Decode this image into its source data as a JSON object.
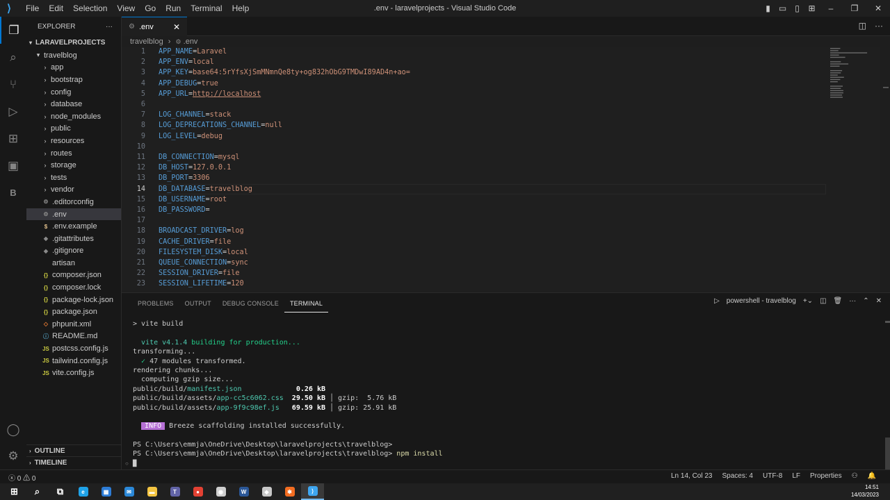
{
  "window": {
    "title": ".env - laravelprojects - Visual Studio Code",
    "menu": [
      "File",
      "Edit",
      "Selection",
      "View",
      "Go",
      "Run",
      "Terminal",
      "Help"
    ]
  },
  "activity": {
    "icons": [
      "files-icon",
      "search-icon",
      "source-control-icon",
      "run-debug-icon",
      "extensions-icon",
      "remote-explorer-icon",
      "b-extension-icon"
    ],
    "bottom_icons": [
      "account-icon",
      "settings-gear-icon"
    ]
  },
  "sidebar": {
    "header": "EXPLORER",
    "root": "LARAVELPROJECTS",
    "items": [
      {
        "label": "travelblog",
        "type": "folder-open",
        "indent": 1
      },
      {
        "label": "app",
        "type": "folder",
        "indent": 2
      },
      {
        "label": "bootstrap",
        "type": "folder",
        "indent": 2
      },
      {
        "label": "config",
        "type": "folder",
        "indent": 2
      },
      {
        "label": "database",
        "type": "folder",
        "indent": 2
      },
      {
        "label": "node_modules",
        "type": "folder",
        "indent": 2
      },
      {
        "label": "public",
        "type": "folder",
        "indent": 2
      },
      {
        "label": "resources",
        "type": "folder",
        "indent": 2
      },
      {
        "label": "routes",
        "type": "folder",
        "indent": 2
      },
      {
        "label": "storage",
        "type": "folder",
        "indent": 2
      },
      {
        "label": "tests",
        "type": "folder",
        "indent": 2
      },
      {
        "label": "vendor",
        "type": "folder",
        "indent": 2
      },
      {
        "label": ".editorconfig",
        "type": "gear",
        "indent": 2
      },
      {
        "label": ".env",
        "type": "gear",
        "indent": 2,
        "selected": true
      },
      {
        "label": ".env.example",
        "type": "dollar",
        "indent": 2
      },
      {
        "label": ".gitattributes",
        "type": "git",
        "indent": 2
      },
      {
        "label": ".gitignore",
        "type": "git",
        "indent": 2
      },
      {
        "label": "artisan",
        "type": "plain",
        "indent": 2
      },
      {
        "label": "composer.json",
        "type": "json",
        "indent": 2
      },
      {
        "label": "composer.lock",
        "type": "json",
        "indent": 2
      },
      {
        "label": "package-lock.json",
        "type": "json",
        "indent": 2
      },
      {
        "label": "package.json",
        "type": "json",
        "indent": 2
      },
      {
        "label": "phpunit.xml",
        "type": "xml",
        "indent": 2
      },
      {
        "label": "README.md",
        "type": "info",
        "indent": 2
      },
      {
        "label": "postcss.config.js",
        "type": "js",
        "indent": 2
      },
      {
        "label": "tailwind.config.js",
        "type": "js",
        "indent": 2
      },
      {
        "label": "vite.config.js",
        "type": "js",
        "indent": 2
      }
    ],
    "outline": "OUTLINE",
    "timeline": "TIMELINE"
  },
  "editor": {
    "tab_label": ".env",
    "breadcrumb_folder": "travelblog",
    "breadcrumb_file": ".env",
    "current_line": 14,
    "lines": [
      {
        "n": "1",
        "key": "APP_NAME",
        "val": "Laravel"
      },
      {
        "n": "2",
        "key": "APP_ENV",
        "val": "local"
      },
      {
        "n": "3",
        "key": "APP_KEY",
        "val": "base64:5rYfsXjSmMNmnQe8ty+og832hOb G9TMDwI89AD4n+ao=",
        "raw": "base64:5rYfsXjSmMNmnQe8ty+og832hObG9TMDwI89AD4n+ao="
      },
      {
        "n": "4",
        "key": "APP_DEBUG",
        "val": "true"
      },
      {
        "n": "5",
        "key": "APP_URL",
        "val": "http://localhost",
        "url": true
      },
      {
        "n": "6",
        "key": "",
        "val": ""
      },
      {
        "n": "7",
        "key": "LOG_CHANNEL",
        "val": "stack"
      },
      {
        "n": "8",
        "key": "LOG_DEPRECATIONS_CHANNEL",
        "val": "null"
      },
      {
        "n": "9",
        "key": "LOG_LEVEL",
        "val": "debug"
      },
      {
        "n": "10",
        "key": "",
        "val": ""
      },
      {
        "n": "11",
        "key": "DB_CONNECTION",
        "val": "mysql"
      },
      {
        "n": "12",
        "key": "DB_HOST",
        "val": "127.0.0.1"
      },
      {
        "n": "13",
        "key": "DB_PORT",
        "val": "3306"
      },
      {
        "n": "14",
        "key": "DB_DATABASE",
        "val": "travelblog"
      },
      {
        "n": "15",
        "key": "DB_USERNAME",
        "val": "root"
      },
      {
        "n": "16",
        "key": "DB_PASSWORD",
        "val": ""
      },
      {
        "n": "17",
        "key": "",
        "val": ""
      },
      {
        "n": "18",
        "key": "BROADCAST_DRIVER",
        "val": "log"
      },
      {
        "n": "19",
        "key": "CACHE_DRIVER",
        "val": "file"
      },
      {
        "n": "20",
        "key": "FILESYSTEM_DISK",
        "val": "local"
      },
      {
        "n": "21",
        "key": "QUEUE_CONNECTION",
        "val": "sync"
      },
      {
        "n": "22",
        "key": "SESSION_DRIVER",
        "val": "file"
      },
      {
        "n": "23",
        "key": "SESSION_LIFETIME",
        "val": "120"
      }
    ]
  },
  "panel": {
    "tabs": [
      "PROBLEMS",
      "OUTPUT",
      "DEBUG CONSOLE",
      "TERMINAL"
    ],
    "active_tab": "TERMINAL",
    "terminal_name": "powershell - travelblog",
    "terminal_lines": [
      {
        "text": "> vite build"
      },
      {
        "text": ""
      },
      {
        "parts": [
          [
            "",
            "  "
          ],
          [
            "c",
            "vite v4.1.4"
          ],
          [
            "g",
            " building for production..."
          ]
        ]
      },
      {
        "text": "transforming..."
      },
      {
        "parts": [
          [
            "",
            "  "
          ],
          [
            "g",
            "✓"
          ],
          [
            "",
            " 47 modules transformed."
          ]
        ]
      },
      {
        "text": "rendering chunks..."
      },
      {
        "text": "  computing gzip size..."
      },
      {
        "parts": [
          [
            "",
            "public/build/"
          ],
          [
            "c",
            "manifest.json"
          ],
          [
            "",
            "             "
          ],
          [
            "b",
            "0.26 kB"
          ]
        ]
      },
      {
        "parts": [
          [
            "",
            "public/build/assets/"
          ],
          [
            "c",
            "app-cc5c6062.css"
          ],
          [
            "",
            "  "
          ],
          [
            "b",
            "29.50 kB"
          ],
          [
            "",
            " │ gzip:  5.76 kB"
          ]
        ]
      },
      {
        "parts": [
          [
            "",
            "public/build/assets/"
          ],
          [
            "c",
            "app-9f9c98ef.js"
          ],
          [
            "",
            "   "
          ],
          [
            "b",
            "69.59 kB"
          ],
          [
            "",
            " │ gzip: 25.91 kB"
          ]
        ]
      },
      {
        "text": ""
      },
      {
        "parts": [
          [
            "",
            "  "
          ],
          [
            "info",
            "INFO"
          ],
          [
            "",
            " Breeze scaffolding installed successfully."
          ]
        ]
      },
      {
        "text": ""
      },
      {
        "text": "PS C:\\Users\\emmja\\OneDrive\\Desktop\\laravelprojects\\travelblog>"
      },
      {
        "parts": [
          [
            "",
            "PS C:\\Users\\emmja\\OneDrive\\Desktop\\laravelprojects\\travelblog> "
          ],
          [
            "y",
            "npm install"
          ]
        ]
      },
      {
        "text": "█"
      }
    ]
  },
  "statusbar": {
    "errors": "0",
    "warnings": "0",
    "position": "Ln 14, Col 23",
    "spaces": "Spaces: 4",
    "encoding": "UTF-8",
    "eol": "LF",
    "language": "Properties"
  },
  "taskbar": {
    "time": "14:51",
    "date": "14/03/2023",
    "apps": [
      {
        "name": "windows-start-icon",
        "color": "#ffffff"
      },
      {
        "name": "search-icon",
        "color": "#ffffff"
      },
      {
        "name": "task-view-icon",
        "color": "#ffffff"
      },
      {
        "name": "edge-icon",
        "color": "#1fa2e8"
      },
      {
        "name": "store-icon",
        "color": "#2d7cd6"
      },
      {
        "name": "mail-icon",
        "color": "#2b88d8"
      },
      {
        "name": "explorer-icon",
        "color": "#f4c542"
      },
      {
        "name": "teams-icon",
        "color": "#6264a7"
      },
      {
        "name": "chrome-icon",
        "color": "#e34133"
      },
      {
        "name": "obs-icon",
        "color": "#cfcfcf"
      },
      {
        "name": "word-icon",
        "color": "#2b5797"
      },
      {
        "name": "git-icon",
        "color": "#c8c8c8"
      },
      {
        "name": "xampp-icon",
        "color": "#f36d21"
      },
      {
        "name": "vscode-icon",
        "color": "#3ea6f0",
        "active": true
      }
    ]
  },
  "colors": {
    "accent": "#0078d4",
    "info_badge": "#b670d6",
    "cyan": "#4ec9b0",
    "green": "#23d18b"
  }
}
